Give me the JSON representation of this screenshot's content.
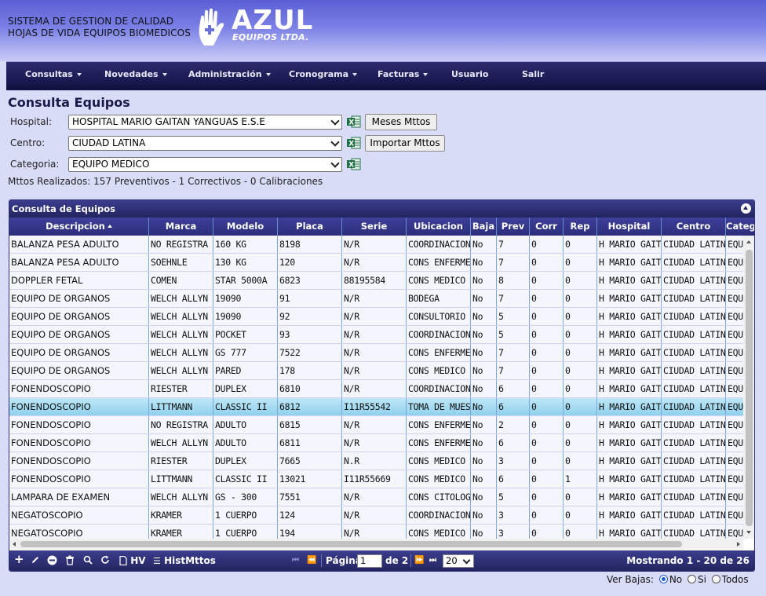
{
  "header": {
    "system_line1": "SISTEMA DE GESTION DE CALIDAD",
    "system_line2": "HOJAS DE VIDA EQUIPOS BIOMEDICOS",
    "logo_name": "AZUL",
    "logo_sub": "EQUIPOS LTDA."
  },
  "nav": {
    "items": [
      {
        "label": "Consultas"
      },
      {
        "label": "Novedades"
      },
      {
        "label": "Administración"
      },
      {
        "label": "Cronograma"
      },
      {
        "label": "Facturas"
      },
      {
        "label": "Usuario"
      },
      {
        "label": "Salir"
      }
    ]
  },
  "form": {
    "title": "Consulta Equipos",
    "hospital_label": "Hospital:",
    "hospital_value": "HOSPITAL MARIO GAITAN YANGUAS E.S.E",
    "centro_label": "Centro:",
    "centro_value": "CIUDAD LATINA",
    "categoria_label": "Categoria:",
    "categoria_value": "EQUIPO MEDICO",
    "meses_btn": "Meses Mttos",
    "importar_btn": "Importar Mttos",
    "summary": "Mttos Realizados: 157 Preventivos - 1 Correctivos - 0 Calibraciones"
  },
  "grid": {
    "caption": "Consulta de Equipos",
    "columns": [
      "Descripcion",
      "Marca",
      "Modelo",
      "Placa",
      "Serie",
      "Ubicacion",
      "Baja",
      "Prev",
      "Corr",
      "Rep",
      "Hospital",
      "Centro",
      "Categoria"
    ],
    "rows": [
      [
        "BALANZA PESA ADULTO",
        "NO REGISTRA",
        "160 KG",
        "8198",
        "N/R",
        "COORDINACION",
        "No",
        "7",
        "0",
        "0",
        "H MARIO GAITAN",
        "CIUDAD LATINA",
        "EQUIPO MEDICO"
      ],
      [
        "BALANZA PESA ADULTO",
        "SOEHNLE",
        "130 KG",
        "120",
        "N/R",
        "CONS ENFERMERIA",
        "No",
        "7",
        "0",
        "0",
        "H MARIO GAITAN",
        "CIUDAD LATINA",
        "EQUIPO MEDICO"
      ],
      [
        "DOPPLER FETAL",
        "COMEN",
        "STAR 5000A",
        "6823",
        "88195584",
        "CONS MEDICO",
        "No",
        "8",
        "0",
        "0",
        "H MARIO GAITAN",
        "CIUDAD LATINA",
        "EQUIPO MEDICO"
      ],
      [
        "EQUIPO DE ORGANOS",
        "WELCH ALLYN",
        "19090",
        "91",
        "N/R",
        "BODEGA",
        "No",
        "7",
        "0",
        "0",
        "H MARIO GAITAN",
        "CIUDAD LATINA",
        "EQUIPO MEDICO"
      ],
      [
        "EQUIPO DE ORGANOS",
        "WELCH ALLYN",
        "19090",
        "92",
        "N/R",
        "CONSULTORIO",
        "No",
        "5",
        "0",
        "0",
        "H MARIO GAITAN",
        "CIUDAD LATINA",
        "EQUIPO MEDICO"
      ],
      [
        "EQUIPO DE ORGANOS",
        "WELCH ALLYN",
        "POCKET",
        "93",
        "N/R",
        "COORDINACION",
        "No",
        "5",
        "0",
        "0",
        "H MARIO GAITAN",
        "CIUDAD LATINA",
        "EQUIPO MEDICO"
      ],
      [
        "EQUIPO DE ORGANOS",
        "WELCH ALLYN",
        "GS 777",
        "7522",
        "N/R",
        "CONS ENFERMERIA",
        "No",
        "7",
        "0",
        "0",
        "H MARIO GAITAN",
        "CIUDAD LATINA",
        "EQUIPO MEDICO"
      ],
      [
        "EQUIPO DE ORGANOS",
        "WELCH ALLYN",
        "PARED",
        "178",
        "N/R",
        "CONS MEDICO",
        "No",
        "7",
        "0",
        "0",
        "H MARIO GAITAN",
        "CIUDAD LATINA",
        "EQUIPO MEDICO"
      ],
      [
        "FONENDOSCOPIO",
        "RIESTER",
        "DUPLEX",
        "6810",
        "N/R",
        "COORDINACION",
        "No",
        "6",
        "0",
        "0",
        "H MARIO GAITAN",
        "CIUDAD LATINA",
        "EQUIPO MEDICO"
      ],
      [
        "FONENDOSCOPIO",
        "LITTMANN",
        "CLASSIC II",
        "6812",
        "I11R55542",
        "TOMA DE MUESTRAS",
        "No",
        "6",
        "0",
        "0",
        "H MARIO GAITAN",
        "CIUDAD LATINA",
        "EQUIPO MEDICO"
      ],
      [
        "FONENDOSCOPIO",
        "NO REGISTRA",
        "ADULTO",
        "6815",
        "N/R",
        "CONS ENFERMERIA",
        "No",
        "2",
        "0",
        "0",
        "H MARIO GAITAN",
        "CIUDAD LATINA",
        "EQUIPO MEDICO"
      ],
      [
        "FONENDOSCOPIO",
        "WELCH ALLYN",
        "ADULTO",
        "6811",
        "N/R",
        "CONS ENFERMERIA",
        "No",
        "6",
        "0",
        "0",
        "H MARIO GAITAN",
        "CIUDAD LATINA",
        "EQUIPO MEDICO"
      ],
      [
        "FONENDOSCOPIO",
        "RIESTER",
        "DUPLEX",
        "7665",
        "N.R",
        "CONS MEDICO",
        "No",
        "3",
        "0",
        "0",
        "H MARIO GAITAN",
        "CIUDAD LATINA",
        "EQUIPO MEDICO"
      ],
      [
        "FONENDOSCOPIO",
        "LITTMANN",
        "CLASSIC II",
        "13021",
        "I11R55669",
        "CONS MEDICO",
        "No",
        "6",
        "0",
        "1",
        "H MARIO GAITAN",
        "CIUDAD LATINA",
        "EQUIPO MEDICO"
      ],
      [
        "LAMPARA DE EXAMEN",
        "WELCH ALLYN",
        "GS - 300",
        "7551",
        "N/R",
        "CONS CITOLOGIA",
        "No",
        "5",
        "0",
        "0",
        "H MARIO GAITAN",
        "CIUDAD LATINA",
        "EQUIPO MEDICO"
      ],
      [
        "NEGATOSCOPIO",
        "KRAMER",
        "1 CUERPO",
        "124",
        "N/R",
        "COORDINACION",
        "No",
        "3",
        "0",
        "0",
        "H MARIO GAITAN",
        "CIUDAD LATINA",
        "EQUIPO MEDICO"
      ],
      [
        "NEGATOSCOPIO",
        "KRAMER",
        "1 CUERPO",
        "194",
        "N/R",
        "CONS MEDICO",
        "No",
        "3",
        "0",
        "0",
        "H MARIO GAITAN",
        "CIUDAD LATINA",
        "EQUIPO MEDICO"
      ]
    ],
    "selected_row": 9
  },
  "pager": {
    "hv": "HV",
    "hist": "HistMttos",
    "pagina_label": "Página",
    "page_value": "1",
    "of_label": "de 2",
    "page_size": "20",
    "showing": "Mostrando 1 - 20 de 26"
  },
  "bajas": {
    "label": "Ver Bajas:",
    "opt_no": "No",
    "opt_si": "Si",
    "opt_todos": "Todos",
    "selected": "No"
  },
  "colors": {
    "header_grad_top": "#5b5fd3",
    "nav_bg": "#1b1c54",
    "grid_bar": "#2c2e74",
    "selected_row": "#a9dcf1",
    "page_bg": "#d9dcf7"
  }
}
